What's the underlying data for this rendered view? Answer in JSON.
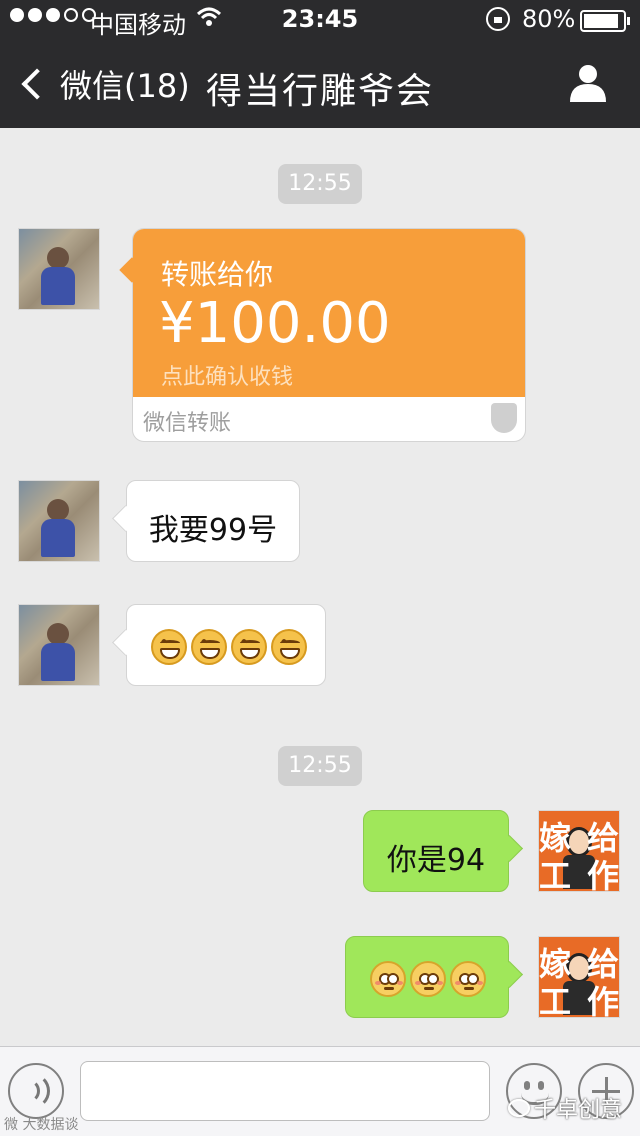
{
  "status_bar": {
    "carrier": "中国移动",
    "time": "23:45",
    "battery_text": "80%",
    "battery_level": 0.8,
    "signal_bars": 3
  },
  "nav": {
    "back_label": "微信(18)",
    "title": "得当行雕爷会"
  },
  "messages": {
    "time1": "12:55",
    "transfer": {
      "label": "转账给你",
      "amount": "¥100.00",
      "hint": "点此确认收钱",
      "brand": "微信转账"
    },
    "friend_text": "我要99号",
    "time2": "12:55",
    "self_text": "你是94",
    "self_avatar_text": [
      "嫁",
      "给",
      "工",
      "作"
    ]
  },
  "watermark": {
    "left": "微 大数据谈",
    "right": "千卓创意"
  },
  "colors": {
    "nav_bg": "#2b2b2d",
    "chat_bg": "#ebebeb",
    "transfer_orange": "#f79e3a",
    "self_bubble": "#a0e75a"
  }
}
